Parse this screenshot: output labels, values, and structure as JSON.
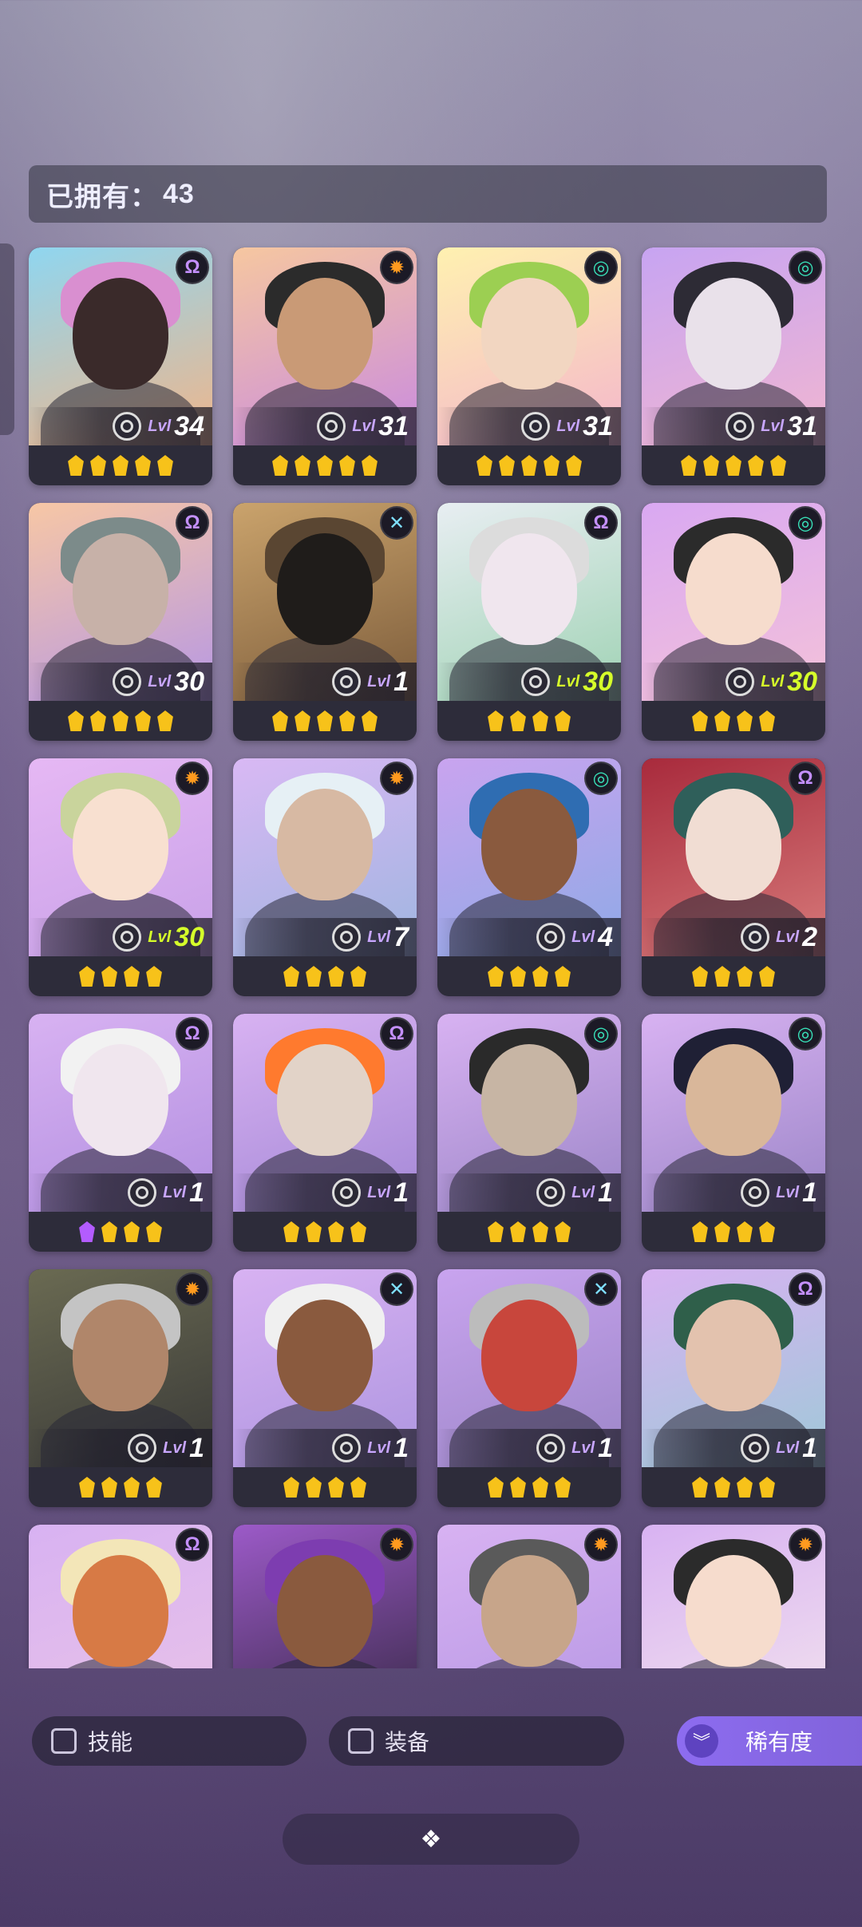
{
  "header": {
    "owned_label": "已拥有：",
    "owned_count": "43"
  },
  "lvl_prefix": "Lvl",
  "filters": {
    "skills_label": "技能",
    "equipment_label": "装备",
    "sort_label": "稀有度"
  },
  "faction_colors": {
    "omega": "#c490ff",
    "sun": "#ff9a1f",
    "swirl": "#38e0b8",
    "cross": "#7fe0ff"
  },
  "heroes": [
    {
      "level": "34",
      "faction": "omega",
      "stars": 5,
      "level_color": "white",
      "bg": [
        "#8fd6f0",
        "#f0b58a"
      ],
      "skin": "#3a2a2a",
      "hair": "#d98fd0"
    },
    {
      "level": "31",
      "faction": "sun",
      "stars": 5,
      "level_color": "white",
      "bg": [
        "#f6c7a0",
        "#c98ae0"
      ],
      "skin": "#c99a76",
      "hair": "#2b2b2b"
    },
    {
      "level": "31",
      "faction": "swirl",
      "stars": 5,
      "level_color": "white",
      "bg": [
        "#fff1b0",
        "#f4b6cc"
      ],
      "skin": "#f2d6c1",
      "hair": "#9ccf52"
    },
    {
      "level": "31",
      "faction": "swirl",
      "stars": 5,
      "level_color": "white",
      "bg": [
        "#c7a4f2",
        "#f1b6d1"
      ],
      "skin": "#e9e1ea",
      "hair": "#2d2b35"
    },
    {
      "level": "30",
      "faction": "omega",
      "stars": 5,
      "level_color": "white",
      "bg": [
        "#f7c7a5",
        "#b697e4"
      ],
      "skin": "#c7b1a8",
      "hair": "#7c8b8a"
    },
    {
      "level": "1",
      "faction": "cross",
      "stars": 5,
      "level_color": "white",
      "bg": [
        "#caa36c",
        "#7c5c3b"
      ],
      "skin": "#1f1c1a",
      "hair": "#5a4632"
    },
    {
      "level": "30",
      "faction": "omega",
      "stars": 4,
      "level_color": "green",
      "bg": [
        "#e8eef2",
        "#9fd2b4"
      ],
      "skin": "#f0e6ee",
      "hair": "#dcdcdc"
    },
    {
      "level": "30",
      "faction": "swirl",
      "stars": 4,
      "level_color": "green",
      "bg": [
        "#d9a8f2",
        "#f4c2d9"
      ],
      "skin": "#f6dccd",
      "hair": "#2b2b2b"
    },
    {
      "level": "30",
      "faction": "sun",
      "stars": 4,
      "level_color": "green",
      "bg": [
        "#e6b8f4",
        "#c8a1e8"
      ],
      "skin": "#f8e0d0",
      "hair": "#c9d49c"
    },
    {
      "level": "7",
      "faction": "sun",
      "stars": 4,
      "level_color": "white",
      "bg": [
        "#d9b8f4",
        "#9fb5e0"
      ],
      "skin": "#d7b9a3",
      "hair": "#e6f0f5"
    },
    {
      "level": "4",
      "faction": "swirl",
      "stars": 4,
      "level_color": "white",
      "bg": [
        "#c9a4ef",
        "#8fa9e6"
      ],
      "skin": "#8a5a3e",
      "hair": "#2f6db2"
    },
    {
      "level": "2",
      "faction": "omega",
      "stars": 4,
      "level_color": "white",
      "bg": [
        "#a82a3c",
        "#d77a7a"
      ],
      "skin": "#f1ddd3",
      "hair": "#2f5f5a"
    },
    {
      "level": "1",
      "faction": "omega",
      "stars": 4,
      "level_color": "white",
      "purple_first": true,
      "bg": [
        "#d8b2f2",
        "#b28fe0"
      ],
      "skin": "#f0e6ee",
      "hair": "#f2f2f2"
    },
    {
      "level": "1",
      "faction": "omega",
      "stars": 4,
      "level_color": "white",
      "bg": [
        "#d8b2f2",
        "#a488d6"
      ],
      "skin": "#e2d3c8",
      "hair": "#ff7a2e"
    },
    {
      "level": "1",
      "faction": "swirl",
      "stars": 4,
      "level_color": "white",
      "bg": [
        "#d8b2f2",
        "#9c86c8"
      ],
      "skin": "#c7b5a4",
      "hair": "#2a2a2a"
    },
    {
      "level": "1",
      "faction": "swirl",
      "stars": 4,
      "level_color": "white",
      "bg": [
        "#d8b2f2",
        "#9c86c8"
      ],
      "skin": "#d9b79a",
      "hair": "#1f2035"
    },
    {
      "level": "1",
      "faction": "sun",
      "stars": 4,
      "level_color": "white",
      "bg": [
        "#6a6a52",
        "#3a3a38"
      ],
      "skin": "#b0866a",
      "hair": "#c4c4c4"
    },
    {
      "level": "1",
      "faction": "cross",
      "stars": 4,
      "level_color": "white",
      "bg": [
        "#d8b2f2",
        "#ad95e0"
      ],
      "skin": "#8a5a3e",
      "hair": "#f0f0f0"
    },
    {
      "level": "1",
      "faction": "cross",
      "stars": 4,
      "level_color": "white",
      "bg": [
        "#c9a4ef",
        "#9c86c8"
      ],
      "skin": "#c8463c",
      "hair": "#bcbcbc"
    },
    {
      "level": "1",
      "faction": "omega",
      "stars": 4,
      "level_color": "white",
      "bg": [
        "#d8b2f2",
        "#9fc9d8"
      ],
      "skin": "#e3c2ae",
      "hair": "#2f5f4a"
    },
    {
      "level": "",
      "faction": "omega",
      "stars": 0,
      "level_color": "white",
      "bg": [
        "#d8b2f2",
        "#e8c2e8"
      ],
      "skin": "#d77a45",
      "hair": "#f3e6b8"
    },
    {
      "level": "",
      "faction": "sun",
      "stars": 0,
      "level_color": "white",
      "bg": [
        "#9c5ac8",
        "#3a2a4a"
      ],
      "skin": "#8a5a3e",
      "hair": "#7d3db0"
    },
    {
      "level": "",
      "faction": "sun",
      "stars": 0,
      "level_color": "white",
      "bg": [
        "#d8b2f2",
        "#b697e4"
      ],
      "skin": "#c7a58a",
      "hair": "#5a5a5a"
    },
    {
      "level": "",
      "faction": "sun",
      "stars": 0,
      "level_color": "white",
      "bg": [
        "#d8b2f2",
        "#f2e2ee"
      ],
      "skin": "#f6dccd",
      "hair": "#2b2b2b"
    }
  ]
}
